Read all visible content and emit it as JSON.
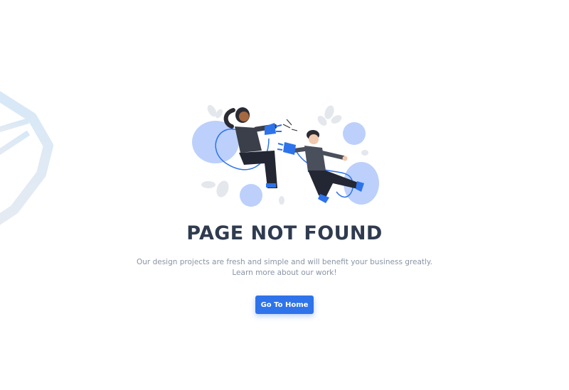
{
  "error": {
    "title": "PAGE NOT FOUND",
    "description_line1": "Our design projects are fresh and simple and will benefit your business greatly.",
    "description_line2": "Learn more about our work!",
    "home_button_label": "Go To Home"
  },
  "colors": {
    "accent": "#2e73ea",
    "title": "#2f3b4f",
    "text_muted": "#8a94a4",
    "blob": "#bcd0fb"
  },
  "illustration": {
    "name": "two-people-unplugged-cable-illustration"
  }
}
